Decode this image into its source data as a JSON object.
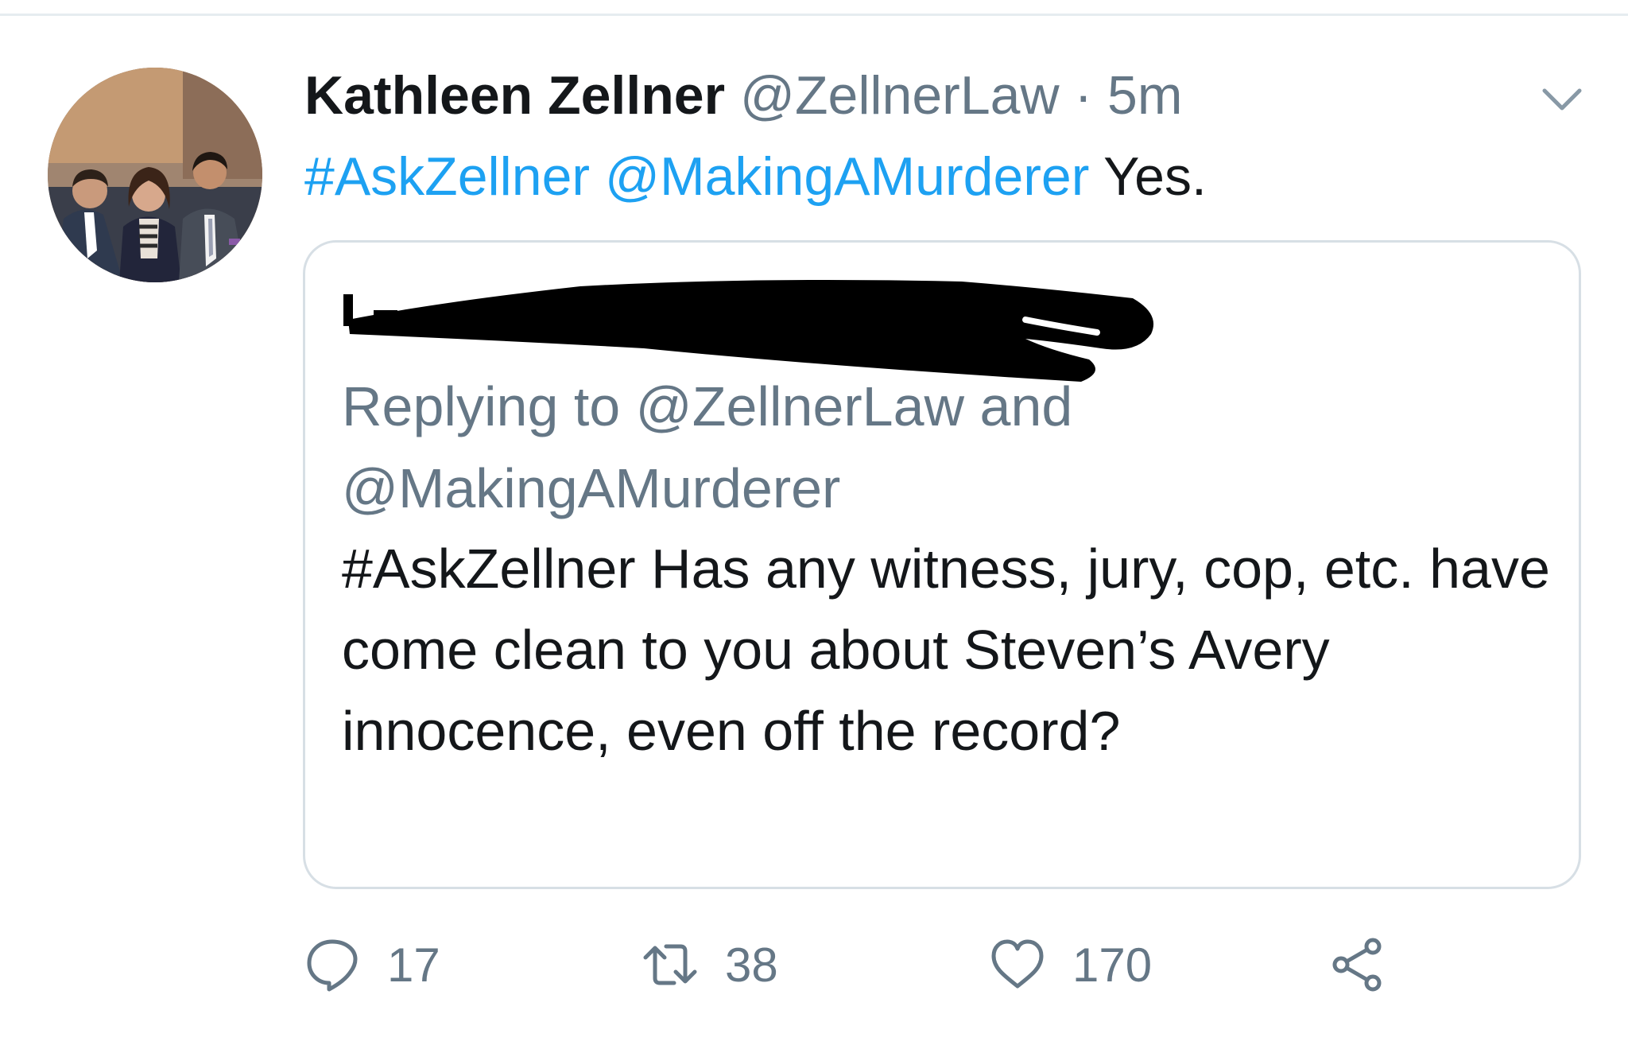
{
  "tweet": {
    "author_name": "Kathleen Zellner",
    "author_handle": "@ZellnerLaw",
    "separator": " · ",
    "timestamp": "5m",
    "hashtag": "#AskZellner",
    "mention": "@MakingAMurderer",
    "text": "Yes.",
    "menu_icon": "chevron-down-icon",
    "avatar_icon": "profile-photo"
  },
  "quoted": {
    "redaction_icon": "scribble-redaction",
    "replying_prefix": "Replying to ",
    "replying_handle_1": "@ZellnerLaw",
    "replying_and": " and ",
    "replying_handle_2": "@MakingAMurderer",
    "body": "#AskZellner Has any witness, jury, cop, etc. have come clean to you about Steven’s Avery innocence, even off the record?"
  },
  "actions": {
    "reply_count": "17",
    "retweet_count": "38",
    "like_count": "170",
    "reply_icon": "reply-icon",
    "retweet_icon": "retweet-icon",
    "like_icon": "heart-icon",
    "share_icon": "share-icon"
  },
  "colors": {
    "link": "#1da1f2",
    "secondary_text": "#657786",
    "primary_text": "#14171a",
    "border": "#d7dfe5"
  }
}
